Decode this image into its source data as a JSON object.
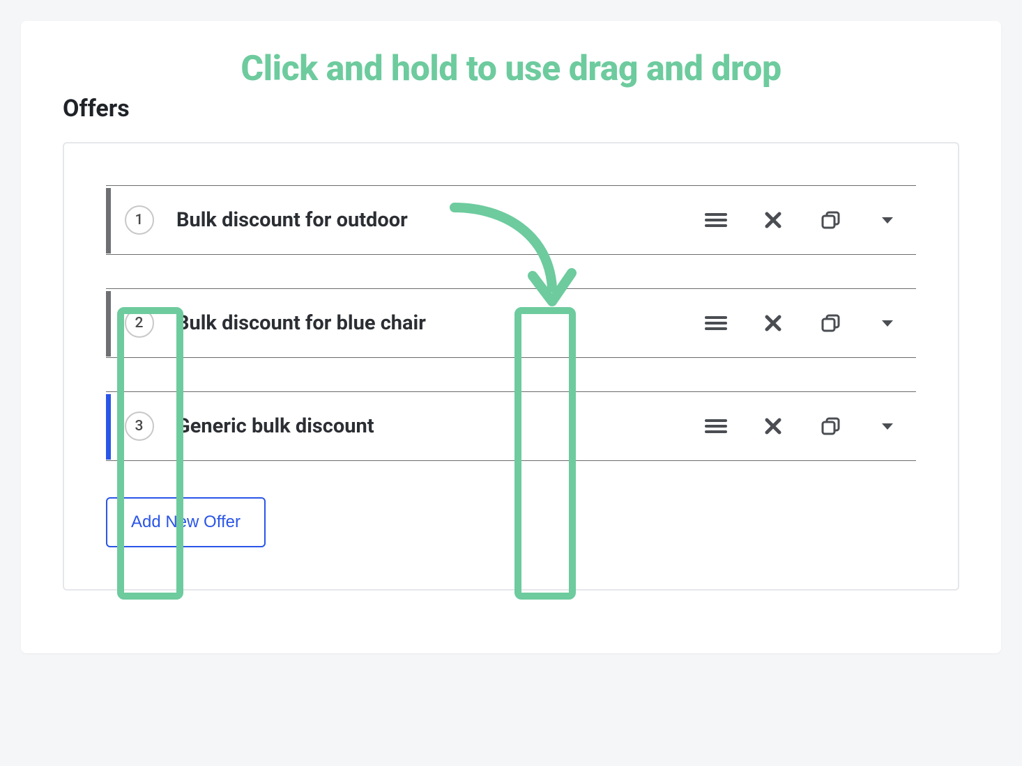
{
  "annotation": {
    "title": "Click and hold to use drag and drop"
  },
  "section": {
    "title": "Offers"
  },
  "offers": [
    {
      "num": "1",
      "title": "Bulk discount for outdoor",
      "indicator": "gray"
    },
    {
      "num": "2",
      "title": "Bulk discount for blue chair",
      "indicator": "gray"
    },
    {
      "num": "3",
      "title": "Generic bulk discount",
      "indicator": "blue"
    }
  ],
  "buttons": {
    "add_new_offer": "Add New Offer"
  }
}
